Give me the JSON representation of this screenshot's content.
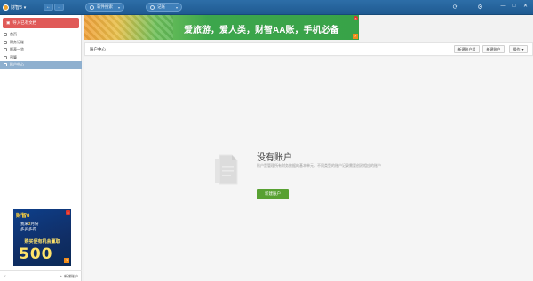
{
  "colors": {
    "topbar": "#2d6ea8",
    "import_button": "#e05a58",
    "primary_button": "#58a132",
    "active_nav": "#8fb0cf"
  },
  "topbar": {
    "app_menu": "财智8",
    "back": "←",
    "forward": "→",
    "search_placeholder": "软件搜索",
    "record_placeholder": "记账",
    "win_min": "—",
    "win_max": "□",
    "win_close": "✕"
  },
  "sidebar": {
    "import_button": "导入已有文档",
    "items": [
      {
        "label": "首页",
        "icon": "home-icon"
      },
      {
        "label": "财务记账",
        "icon": "ledger-icon"
      },
      {
        "label": "报表一览",
        "icon": "report-icon"
      },
      {
        "label": "预算",
        "icon": "budget-icon"
      },
      {
        "label": "账户中心",
        "icon": "account-icon",
        "active": true
      }
    ],
    "ad": {
      "brand": "财智8",
      "line1_prefix": "我来",
      "line1_highlight": "2",
      "line1_suffix": "月份",
      "line2": "多买多得",
      "band": "购买便有机会赢取",
      "amount": "500"
    },
    "footer": {
      "collapse": "«",
      "new_account": "新增账户"
    }
  },
  "banner": {
    "slogan": "爱旅游，爱人类，财智AA账，手机必备",
    "badge": "?"
  },
  "toolbar": {
    "title": "账户中心",
    "buttons": [
      "新建账户组",
      "新建账户",
      "操作"
    ]
  },
  "empty_state": {
    "title": "没有账户",
    "description": "账户是管理所有财务数据的基本单元，不同类型的账户记录需要创建相应的账户",
    "button": "新建账户"
  }
}
